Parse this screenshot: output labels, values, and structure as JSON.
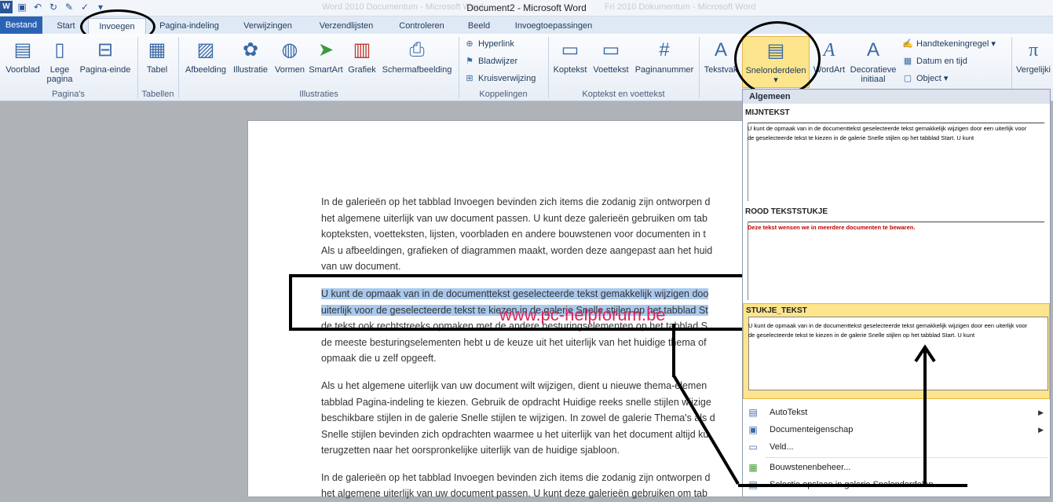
{
  "window": {
    "title": "Document2 - Microsoft Word",
    "faint_left": "Word 2010 Documentum - Microsoft Word",
    "faint_right": "Fri 2010 Dokumentum - Microsoft Word"
  },
  "tabs": [
    {
      "label": "Bestand"
    },
    {
      "label": "Start"
    },
    {
      "label": "Invoegen"
    },
    {
      "label": "Pagina-indeling"
    },
    {
      "label": "Verwijzingen"
    },
    {
      "label": "Verzendlijsten"
    },
    {
      "label": "Controleren"
    },
    {
      "label": "Beeld"
    },
    {
      "label": "Invoegtoepassingen"
    }
  ],
  "ribbon": {
    "pages": {
      "voorblad": "Voorblad",
      "lege1": "Lege",
      "lege2": "pagina",
      "einde": "Pagina-einde",
      "group": "Pagina's"
    },
    "tables": {
      "tabel": "Tabel",
      "group": "Tabellen"
    },
    "illus": {
      "afbeelding": "Afbeelding",
      "illustratie": "Illustratie",
      "vormen": "Vormen",
      "smartart": "SmartArt",
      "grafiek": "Grafiek",
      "scherm": "Schermafbeelding",
      "group": "Illustraties"
    },
    "links": {
      "hyperlink": "Hyperlink",
      "bladwijzer": "Bladwijzer",
      "kruis": "Kruisverwijzing",
      "group": "Koppelingen"
    },
    "header": {
      "koptekst": "Koptekst",
      "voettekst": "Voettekst",
      "paginanummer": "Paginanummer",
      "group": "Koptekst en voettekst"
    },
    "text": {
      "tekstvak": "Tekstvak",
      "snel": "Snelonderdelen",
      "wordart": "WordArt",
      "deco1": "Decoratieve",
      "deco2": "initiaal",
      "hand": "Handtekeningregel",
      "datum": "Datum en tijd",
      "object": "Object"
    },
    "eq": {
      "verg": "Vergelijki"
    }
  },
  "document": {
    "p1": [
      "In de galerieën op het tabblad Invoegen bevinden zich items die zodanig zijn ontworpen d",
      "het algemene uiterlijk van uw document passen. U kunt deze galerieën gebruiken om tab",
      "kopteksten, voetteksten, lijsten, voorbladen en andere bouwstenen voor documenten in t",
      "Als u afbeeldingen, grafieken of diagrammen maakt, worden deze aangepast aan het huid",
      "van uw document."
    ],
    "p2": [
      "U kunt de opmaak van in de documenttekst geselecteerde tekst gemakkelijk wijzigen doo",
      "uiterlijk voor de geselecteerde tekst te kiezen in de galerie Snelle stijlen op het tabblad St",
      "de tekst ook rechtstreeks opmaken met de andere besturingselementen op het tabblad S",
      "de meeste besturingselementen hebt u de keuze uit het uiterlijk van het huidige thema of",
      "opmaak die u zelf opgeeft."
    ],
    "p3": [
      "Als u het algemene uiterlijk van uw document wilt wijzigen, dient u nieuwe thema-elemen",
      "tabblad Pagina-indeling te kiezen. Gebruik de opdracht Huidige reeks snelle stijlen wijzige",
      "beschikbare stijlen in de galerie Snelle stijlen te wijzigen. In zowel de galerie Thema's als d",
      "Snelle stijlen bevinden zich opdrachten waarmee u het uiterlijk van het document altijd ku",
      "terugzetten naar het oorspronkelijke uiterlijk van de huidige sjabloon."
    ],
    "p4": [
      "In de galerieën op het tabblad Invoegen bevinden zich items die zodanig zijn ontworpen d",
      "het algemene uiterlijk van uw document passen. U kunt deze galerieën gebruiken om tab"
    ]
  },
  "watermark": "www.pc-helpforum.be",
  "gallery": {
    "header": "Algemeen",
    "items": [
      {
        "name": "MIJNTEKST",
        "preview": "U kunt de opmaak van in de documenttekst geselecteerde tekst gemakkelijk wijzigen door een uiterlijk voor de geselecteerde tekst te kiezen in de galerie Snelle stijlen op het tabblad Start. U kunt"
      },
      {
        "name": "ROOD TEKSTSTUKJE",
        "preview": "Deze tekst wensen we in meerdere documenten te bewaren."
      },
      {
        "name": "STUKJE_TEKST",
        "preview": "U kunt de opmaak van in de documenttekst geselecteerde tekst gemakkelijk wijzigen door een uiterlijk voor de geselecteerde tekst te kiezen in de galerie Snelle stijlen op het tabblad Start. U kunt"
      }
    ],
    "menu": [
      {
        "label": "AutoTekst",
        "arrow": "▶"
      },
      {
        "label": "Documenteigenschap",
        "arrow": "▶"
      },
      {
        "label": "Veld..."
      },
      {
        "label": "Bouwstenenbeheer..."
      },
      {
        "label": "Selectie opslaan in galerie Snelonderdelen..."
      }
    ]
  },
  "colors": {
    "file_tab": "#2a63b4",
    "selection": "#a9c9ee",
    "watermark": "#e0235a",
    "red_text": "#c00000",
    "gallery_selected": "#fde58d"
  }
}
